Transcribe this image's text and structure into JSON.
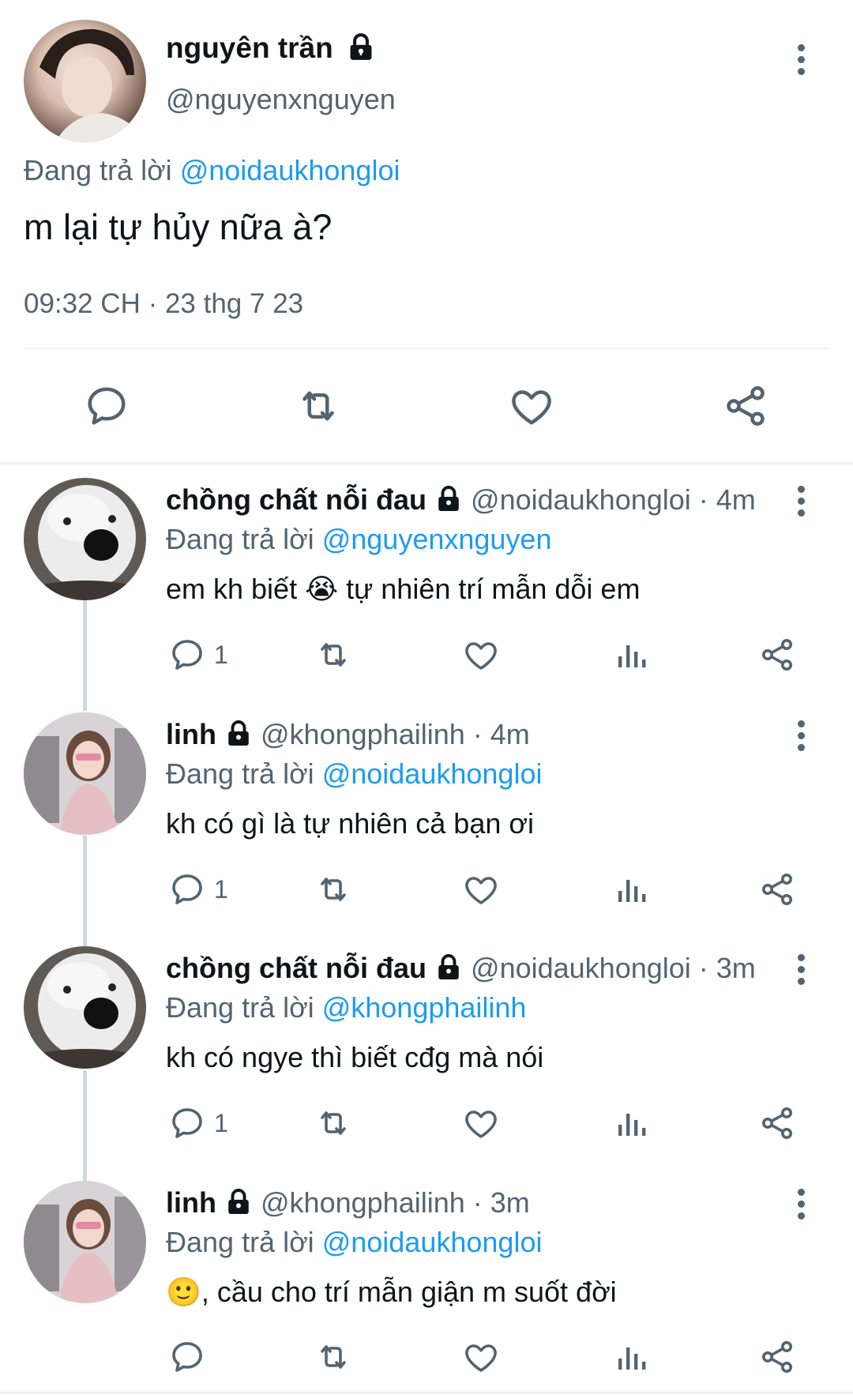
{
  "main_tweet": {
    "author_name": "nguyên trần",
    "handle": "@nguyenxnguyen",
    "replying_label": "Đang trả lời",
    "replying_to": "@noidaukhongloi",
    "text": "m lại tự hủy nữa à?",
    "timestamp": "09:32 CH · 23 thg 7 23"
  },
  "replies": [
    {
      "name": "chồng chất nỗi đau",
      "handle": "@noidaukhongloi",
      "time": " · 4m",
      "replying_label": "Đang trả lời",
      "replying_to": "@nguyenxnguyen",
      "text_before": "em kh biết ",
      "emoji": "😭",
      "text_after": " tự nhiên trí mẫn dỗi em",
      "reply_count": "1"
    },
    {
      "name": "linh",
      "handle": "@khongphailinh",
      "time": " · 4m",
      "replying_label": "Đang trả lời",
      "replying_to": "@noidaukhongloi",
      "text": "kh có gì là tự nhiên cả bạn ơi",
      "reply_count": "1"
    },
    {
      "name": "chồng chất nỗi đau",
      "handle": "@noidaukhongloi",
      "time": " · 3m",
      "replying_label": "Đang trả lời",
      "replying_to": "@khongphailinh",
      "text": "kh có ngye thì biết cđg mà nói",
      "reply_count": "1"
    },
    {
      "name": "linh",
      "handle": "@khongphailinh",
      "time": " · 3m",
      "replying_label": "Đang trả lời",
      "replying_to": "@noidaukhongloi",
      "emoji": "🙂",
      "text_after": ", cầu cho trí mẫn giận m suốt đời",
      "reply_count": ""
    }
  ],
  "icons": [
    "reply-icon",
    "retweet-icon",
    "like-icon",
    "views-icon",
    "share-icon",
    "lock-icon",
    "more-icon"
  ],
  "colors": {
    "text": "#0f1419",
    "secondary": "#536471",
    "link": "#1d9bf0",
    "divider": "#eff3f4"
  }
}
